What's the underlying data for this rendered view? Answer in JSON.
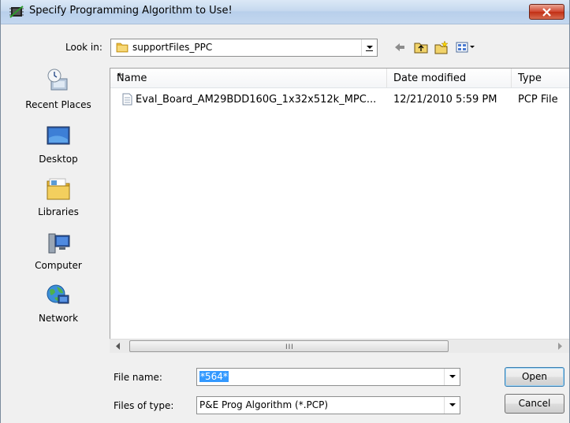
{
  "window": {
    "title": "Specify Programming Algorithm to Use!"
  },
  "lookin": {
    "label": "Look in:",
    "value": "supportFiles_PPC"
  },
  "places": [
    {
      "label": "Recent Places",
      "icon": "recent-places-icon"
    },
    {
      "label": "Desktop",
      "icon": "desktop-icon"
    },
    {
      "label": "Libraries",
      "icon": "libraries-icon"
    },
    {
      "label": "Computer",
      "icon": "computer-icon"
    },
    {
      "label": "Network",
      "icon": "network-icon"
    }
  ],
  "columns": {
    "name": "Name",
    "date": "Date modified",
    "type": "Type"
  },
  "files": [
    {
      "name": "Eval_Board_AM29BDD160G_1x32x512k_MPC...",
      "date": "12/21/2010 5:59 PM",
      "type": "PCP File"
    }
  ],
  "scroll": {
    "grip": "III"
  },
  "filename": {
    "label": "File name:",
    "value": "*564*"
  },
  "filetype": {
    "label": "Files of type:",
    "value": "P&E Prog Algorithm (*.PCP)"
  },
  "buttons": {
    "open": "Open",
    "cancel": "Cancel"
  }
}
